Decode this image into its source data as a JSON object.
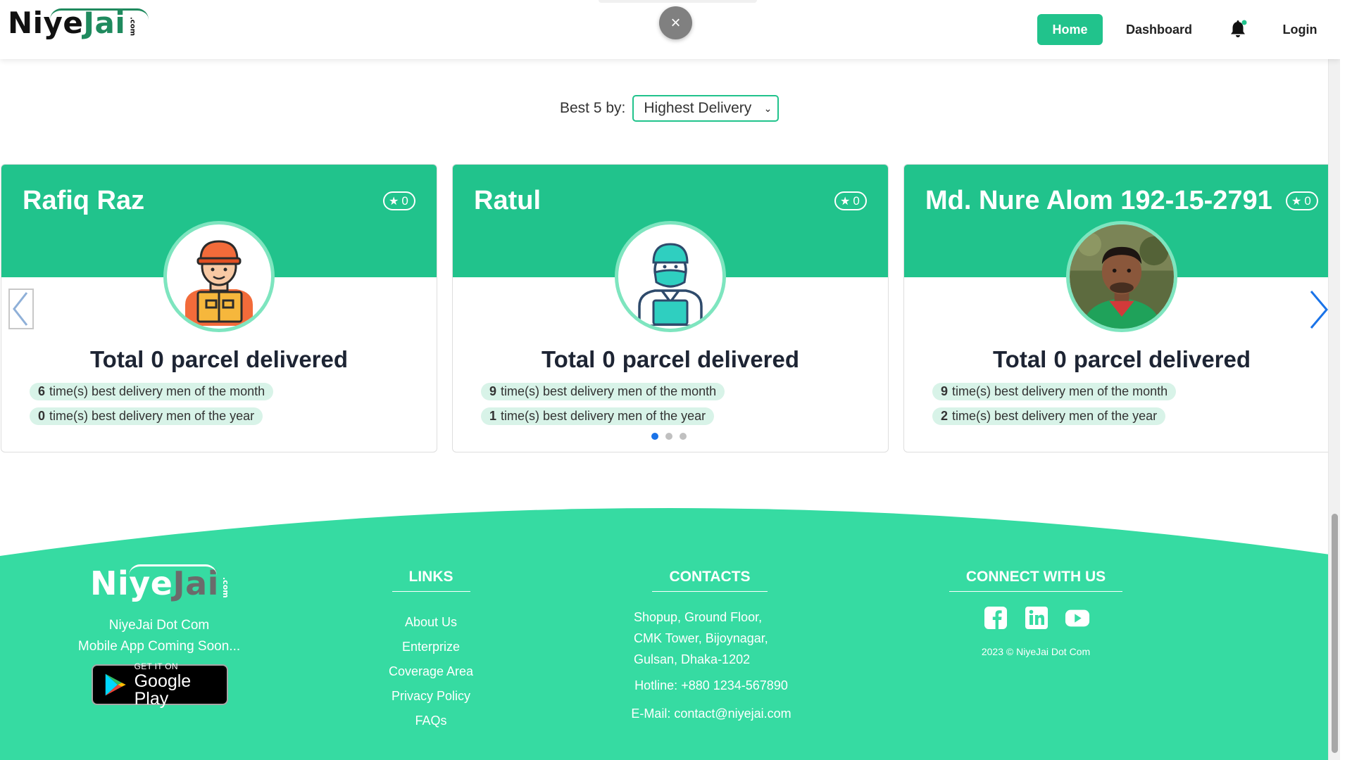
{
  "header": {
    "logo_word": "NiyeJai",
    "logo_dotcom": ".com",
    "nav": {
      "home": "Home",
      "dashboard": "Dashboard",
      "login": "Login"
    },
    "close_symbol": "×"
  },
  "filter": {
    "label": "Best 5 by:",
    "selected": "Highest Delivery"
  },
  "cards": [
    {
      "name": "Rafiq Raz",
      "rating": "0",
      "total_prefix": "Total",
      "total_count": "0",
      "total_suffix": "parcel delivered",
      "month_count": "6",
      "month_text": "time(s) best delivery men of the month",
      "year_count": "0",
      "year_text": "time(s) best delivery men of the year",
      "avatar": "delivery-man-with-box-illustration"
    },
    {
      "name": "Ratul",
      "rating": "0",
      "total_prefix": "Total",
      "total_count": "0",
      "total_suffix": "parcel delivered",
      "month_count": "9",
      "month_text": "time(s) best delivery men of the month",
      "year_count": "1",
      "year_text": "time(s) best delivery men of the year",
      "avatar": "masked-courier-illustration"
    },
    {
      "name": "Md. Nure Alom 192-15-2791",
      "rating": "0",
      "total_prefix": "Total",
      "total_count": "0",
      "total_suffix": "parcel delivered",
      "month_count": "9",
      "month_text": "time(s) best delivery men of the month",
      "year_count": "2",
      "year_text": "time(s) best delivery men of the year",
      "avatar": "person-photo"
    }
  ],
  "carousel": {
    "dot_count": 3,
    "active_dot": 1
  },
  "footer": {
    "brand_name": "NiyeJai Dot Com",
    "brand_tagline": "Mobile App Coming Soon...",
    "gplay_small": "GET IT ON",
    "gplay_big": "Google Play",
    "links_heading": "LINKS",
    "links": [
      "About Us",
      "Enterprize",
      "Coverage Area",
      "Privacy Policy",
      "FAQs"
    ],
    "contacts_heading": "CONTACTS",
    "address_lines": [
      "Shopup, Ground Floor,",
      "CMK Tower, Bijoynagar,",
      "Gulsan, Dhaka-1202"
    ],
    "hotline": "Hotline: +880 1234-567890",
    "email": "E-Mail: contact@niyejai.com",
    "connect_heading": "CONNECT WITH US",
    "socials": [
      "facebook-icon",
      "linkedin-icon",
      "youtube-icon"
    ],
    "copyright": "2023 © NiyeJai Dot Com"
  },
  "colors": {
    "brand_green": "#21c38c",
    "footer_green": "#36dba2",
    "badge_bg": "#d8f3e8",
    "active_dot": "#1a73e8"
  }
}
